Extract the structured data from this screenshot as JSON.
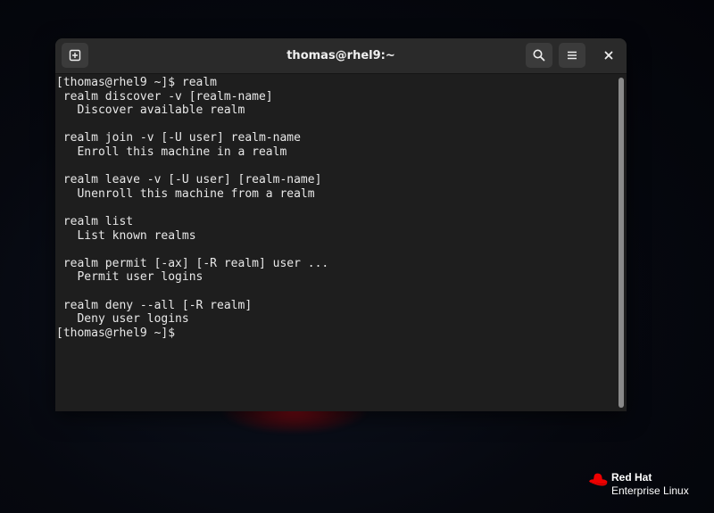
{
  "window": {
    "title": "thomas@rhel9:~",
    "buttons": {
      "new_tab_icon": "new-tab-icon",
      "search_icon": "search-icon",
      "menu_icon": "hamburger-menu-icon",
      "close_icon": "close-icon"
    }
  },
  "terminal": {
    "lines": [
      "[thomas@rhel9 ~]$ realm",
      " realm discover -v [realm-name]",
      "   Discover available realm",
      "",
      " realm join -v [-U user] realm-name",
      "   Enroll this machine in a realm",
      "",
      " realm leave -v [-U user] [realm-name]",
      "   Unenroll this machine from a realm",
      "",
      " realm list",
      "   List known realms",
      "",
      " realm permit [-ax] [-R realm] user ...",
      "   Permit user logins",
      "",
      " realm deny --all [-R realm]",
      "   Deny user logins",
      "[thomas@rhel9 ~]$ "
    ]
  },
  "brand": {
    "line1": "Red Hat",
    "line2": "Enterprise Linux",
    "logo_icon": "red-hat-logo-icon"
  },
  "colors": {
    "terminal_bg": "#1e1e1e",
    "headerbar_bg": "#2a2a2a",
    "text": "#e8e8e8",
    "brand_red": "#ee0000"
  }
}
